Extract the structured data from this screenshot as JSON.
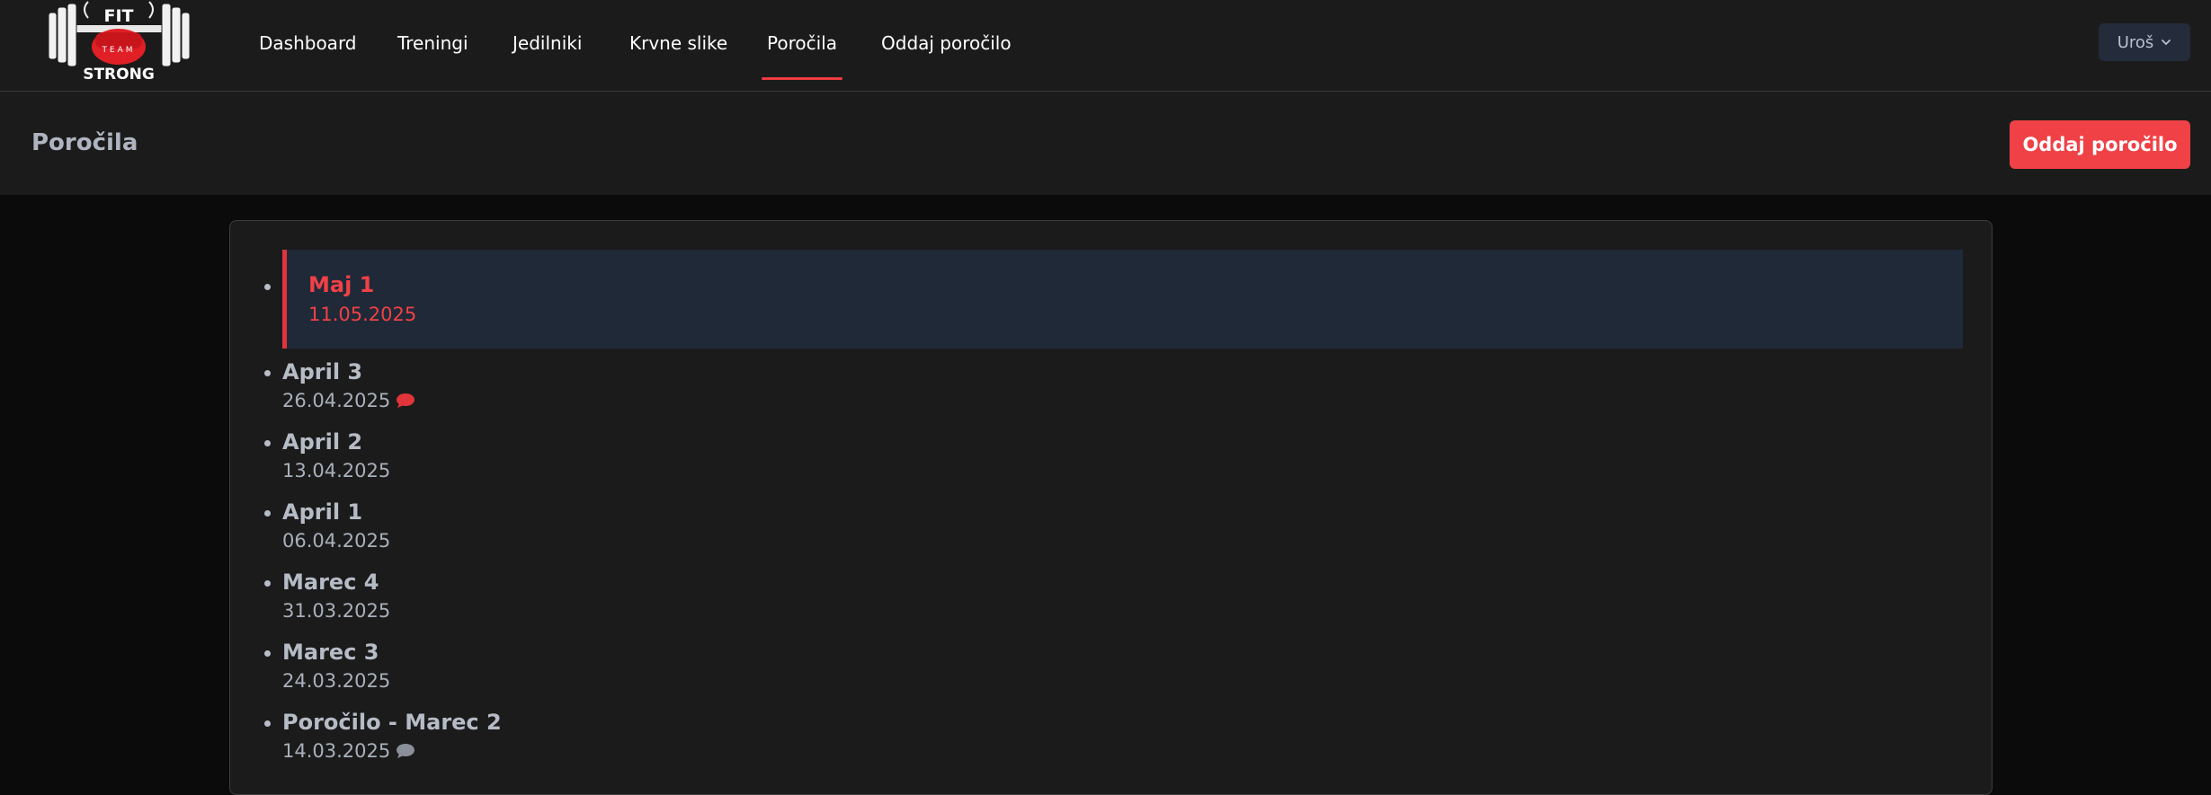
{
  "nav": {
    "logo_text_top": "FIT",
    "logo_text_mid": "TEAM",
    "logo_text_bottom": "STRONG",
    "links": [
      {
        "label": "Dashboard",
        "active": false
      },
      {
        "label": "Treningi",
        "active": false
      },
      {
        "label": "Jedilniki",
        "active": false
      },
      {
        "label": "Krvne slike",
        "active": false
      },
      {
        "label": "Poročila",
        "active": true
      },
      {
        "label": "Oddaj poročilo",
        "active": false
      }
    ],
    "user": "Uroš"
  },
  "header": {
    "title": "Poročila",
    "submit_label": "Oddaj poročilo"
  },
  "reports": [
    {
      "title": "Maj 1",
      "date": "11.05.2025",
      "active": true,
      "comment": "none"
    },
    {
      "title": "April 3",
      "date": "26.04.2025",
      "active": false,
      "comment": "unread"
    },
    {
      "title": "April 2",
      "date": "13.04.2025",
      "active": false,
      "comment": "none"
    },
    {
      "title": "April 1",
      "date": "06.04.2025",
      "active": false,
      "comment": "none"
    },
    {
      "title": "Marec 4",
      "date": "31.03.2025",
      "active": false,
      "comment": "none"
    },
    {
      "title": "Marec 3",
      "date": "24.03.2025",
      "active": false,
      "comment": "none"
    },
    {
      "title": "Poročilo - Marec 2",
      "date": "14.03.2025",
      "active": false,
      "comment": "read"
    }
  ],
  "colors": {
    "accent": "#ef4146",
    "active_bg": "#202938",
    "comment_unread": "#e2353b",
    "comment_read": "#8a8f99"
  },
  "icons": {
    "comment": "chat-bubble-icon",
    "user_menu": "chevron-down-icon"
  }
}
